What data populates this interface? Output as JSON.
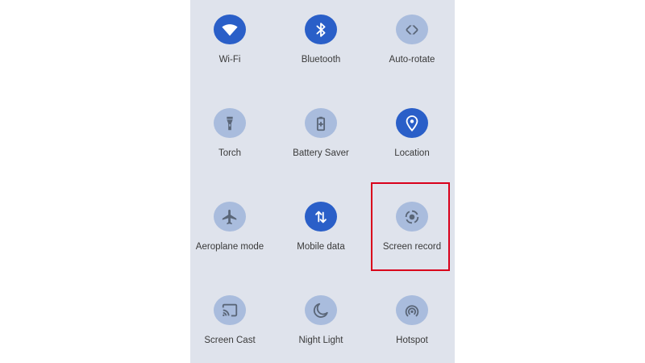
{
  "colors": {
    "panel_background": "#dfe3ec",
    "tile_on": "#2a5fc8",
    "tile_off": "#a9bcdd",
    "icon_on": "#ffffff",
    "icon_off": "#5a6678",
    "highlight": "#d9001b"
  },
  "quick_settings": {
    "tiles": [
      {
        "label": "Wi-Fi",
        "icon": "wifi-icon",
        "state": "on"
      },
      {
        "label": "Bluetooth",
        "icon": "bluetooth-icon",
        "state": "on"
      },
      {
        "label": "Auto-rotate",
        "icon": "auto-rotate-icon",
        "state": "off"
      },
      {
        "label": "Torch",
        "icon": "torch-icon",
        "state": "off"
      },
      {
        "label": "Battery Saver",
        "icon": "battery-saver-icon",
        "state": "off"
      },
      {
        "label": "Location",
        "icon": "location-icon",
        "state": "on"
      },
      {
        "label": "Aeroplane mode",
        "icon": "aeroplane-icon",
        "state": "off"
      },
      {
        "label": "Mobile data",
        "icon": "mobile-data-icon",
        "state": "on"
      },
      {
        "label": "Screen record",
        "icon": "screen-record-icon",
        "state": "off"
      },
      {
        "label": "Screen Cast",
        "icon": "screen-cast-icon",
        "state": "off"
      },
      {
        "label": "Night Light",
        "icon": "night-light-icon",
        "state": "off"
      },
      {
        "label": "Hotspot",
        "icon": "hotspot-icon",
        "state": "off"
      }
    ],
    "highlighted_tile": "Screen record"
  }
}
